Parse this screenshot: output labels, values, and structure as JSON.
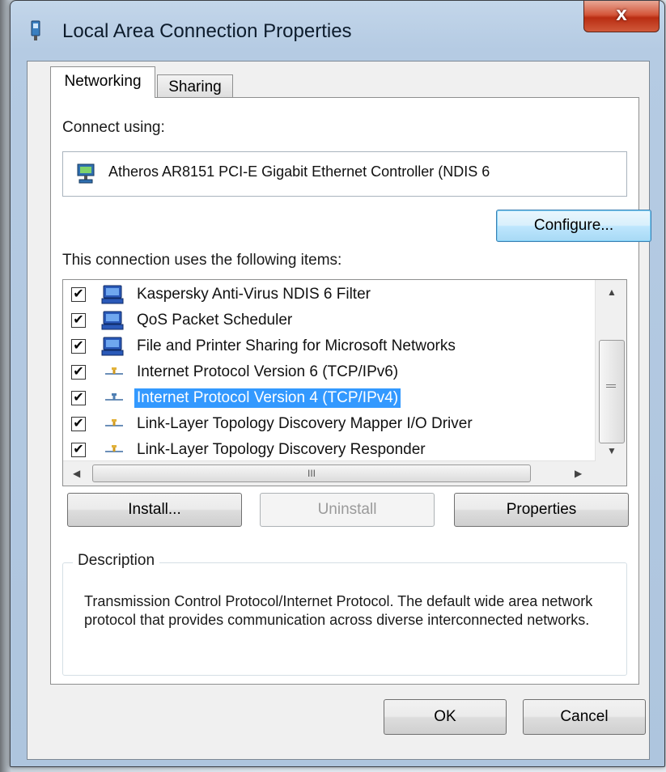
{
  "window": {
    "title": "Local Area Connection Properties",
    "close_label": "x",
    "title_icon": "network-adapter-icon"
  },
  "tabs": [
    {
      "label": "Networking",
      "active": true
    },
    {
      "label": "Sharing",
      "active": false
    }
  ],
  "connect_using": {
    "label": "Connect using:",
    "adapter_name": "Atheros AR8151 PCI-E Gigabit Ethernet Controller (NDIS 6",
    "adapter_icon": "network-adapter-icon",
    "configure_button": "Configure..."
  },
  "items_section": {
    "label": "This connection uses the following items:",
    "items": [
      {
        "label": "Kaspersky Anti-Virus NDIS 6 Filter",
        "checked": true,
        "icon": "service-icon",
        "selected": false
      },
      {
        "label": "QoS Packet Scheduler",
        "checked": true,
        "icon": "service-icon",
        "selected": false
      },
      {
        "label": "File and Printer Sharing for Microsoft Networks",
        "checked": true,
        "icon": "service-icon",
        "selected": false
      },
      {
        "label": "Internet Protocol Version 6 (TCP/IPv6)",
        "checked": true,
        "icon": "protocol-icon",
        "selected": false
      },
      {
        "label": "Internet Protocol Version 4 (TCP/IPv4)",
        "checked": true,
        "icon": "protocol-icon",
        "selected": true
      },
      {
        "label": "Link-Layer Topology Discovery Mapper I/O Driver",
        "checked": true,
        "icon": "protocol-icon",
        "selected": false
      },
      {
        "label": "Link-Layer Topology Discovery Responder",
        "checked": true,
        "icon": "protocol-icon",
        "selected": false
      }
    ],
    "scroll_thumb_grip": "III"
  },
  "buttons": {
    "install": "Install...",
    "uninstall": "Uninstall",
    "properties": "Properties",
    "ok": "OK",
    "cancel": "Cancel"
  },
  "description": {
    "legend": "Description",
    "text": "Transmission Control Protocol/Internet Protocol. The default wide area network protocol that provides communication across diverse interconnected networks."
  },
  "colors": {
    "selection": "#3399ff",
    "title_bar": "#b5cbe3",
    "close_button": "#c73d1f"
  }
}
